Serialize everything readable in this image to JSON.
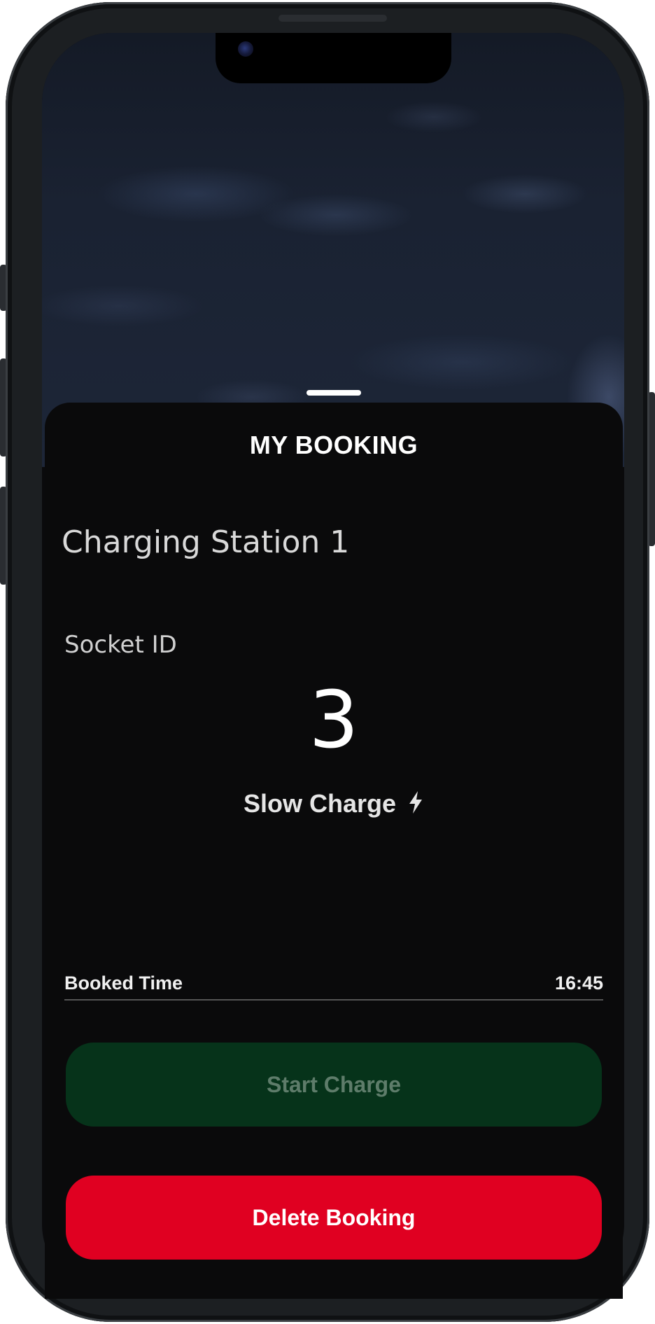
{
  "sheet": {
    "title": "MY BOOKING",
    "station_name": "Charging Station 1",
    "socket_label": "Socket ID",
    "socket_id": "3",
    "charge_type": "Slow Charge",
    "charge_icon": "lightning-bolt-icon",
    "booked_time_label": "Booked Time",
    "booked_time_value": "16:45"
  },
  "actions": {
    "start_label": "Start Charge",
    "delete_label": "Delete Booking"
  },
  "colors": {
    "start_bg": "#06331a",
    "start_text": "#5e7c6a",
    "delete_bg": "#e00021",
    "sheet_bg": "#0a0a0b"
  }
}
